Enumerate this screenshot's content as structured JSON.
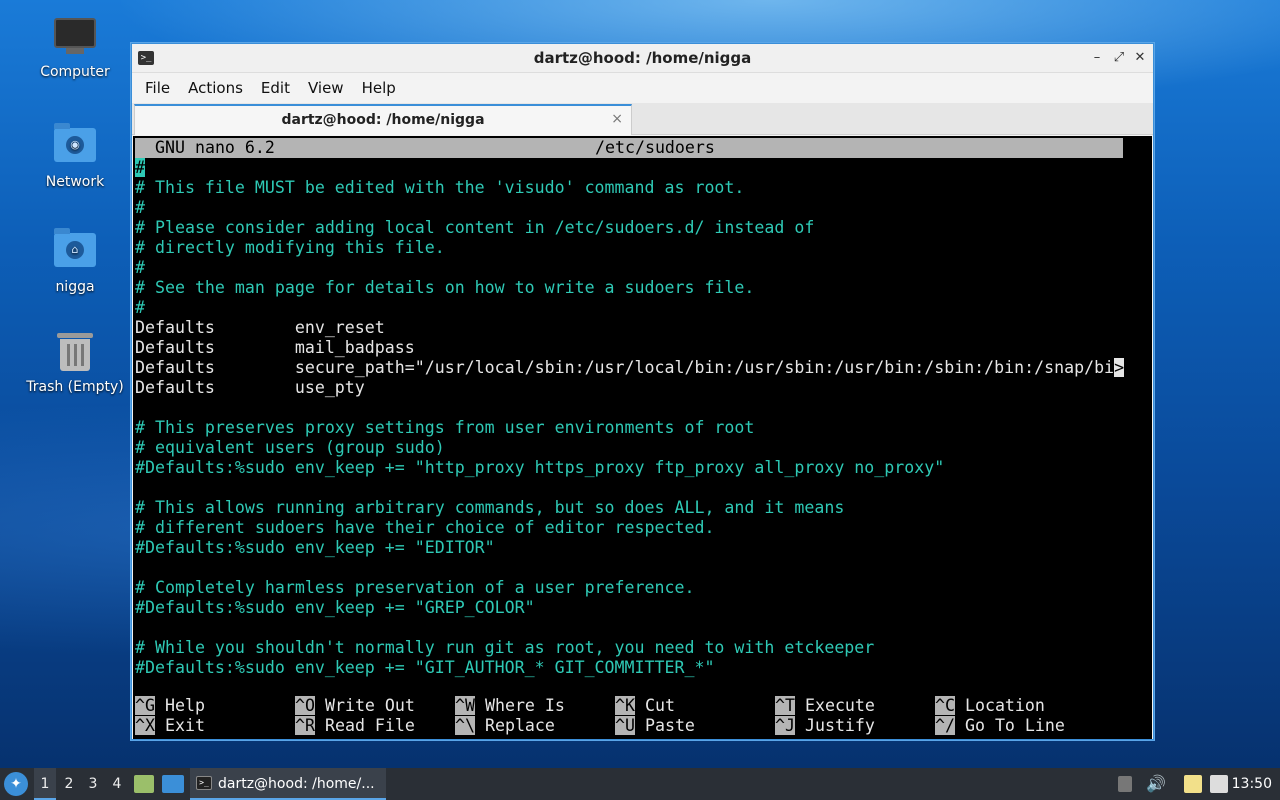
{
  "desktop": {
    "icons": [
      {
        "label": "Computer",
        "icon": "computer-icon"
      },
      {
        "label": "Network",
        "icon": "network-folder-icon"
      },
      {
        "label": "nigga",
        "icon": "home-folder-icon"
      },
      {
        "label": "Trash (Empty)",
        "icon": "trash-icon"
      }
    ]
  },
  "window": {
    "title": "dartz@hood: /home/nigga",
    "menu": [
      "File",
      "Actions",
      "Edit",
      "View",
      "Help"
    ],
    "tab_label": "dartz@hood: /home/nigga",
    "tab_close": "×",
    "controls": {
      "minimize": "–",
      "maximize": "⤢",
      "close": "✕"
    }
  },
  "nano": {
    "version": "GNU nano 6.2",
    "filename": "/etc/sudoers",
    "lines": [
      "#",
      "# This file MUST be edited with the 'visudo' command as root.",
      "#",
      "# Please consider adding local content in /etc/sudoers.d/ instead of",
      "# directly modifying this file.",
      "#",
      "# See the man page for details on how to write a sudoers file.",
      "#",
      "Defaults        env_reset",
      "Defaults        mail_badpass",
      "Defaults        secure_path=\"/usr/local/sbin:/usr/local/bin:/usr/sbin:/usr/bin:/sbin:/bin:/snap/bi",
      "Defaults        use_pty",
      "",
      "# This preserves proxy settings from user environments of root",
      "# equivalent users (group sudo)",
      "#Defaults:%sudo env_keep += \"http_proxy https_proxy ftp_proxy all_proxy no_proxy\"",
      "",
      "# This allows running arbitrary commands, but so does ALL, and it means",
      "# different sudoers have their choice of editor respected.",
      "#Defaults:%sudo env_keep += \"EDITOR\"",
      "",
      "# Completely harmless preservation of a user preference.",
      "#Defaults:%sudo env_keep += \"GREP_COLOR\"",
      "",
      "# While you shouldn't normally run git as root, you need to with etckeeper",
      "#Defaults:%sudo env_keep += \"GIT_AUTHOR_* GIT_COMMITTER_*\""
    ],
    "truncation_marker": ">",
    "shortcuts": [
      [
        {
          "key": "^G",
          "label": "Help"
        },
        {
          "key": "^O",
          "label": "Write Out"
        },
        {
          "key": "^W",
          "label": "Where Is"
        },
        {
          "key": "^K",
          "label": "Cut"
        },
        {
          "key": "^T",
          "label": "Execute"
        },
        {
          "key": "^C",
          "label": "Location"
        }
      ],
      [
        {
          "key": "^X",
          "label": "Exit"
        },
        {
          "key": "^R",
          "label": "Read File"
        },
        {
          "key": "^\\",
          "label": "Replace"
        },
        {
          "key": "^U",
          "label": "Paste"
        },
        {
          "key": "^J",
          "label": "Justify"
        },
        {
          "key": "^/",
          "label": "Go To Line"
        }
      ]
    ]
  },
  "taskbar": {
    "workspaces": [
      "1",
      "2",
      "3",
      "4"
    ],
    "active_workspace": "1",
    "task_label": "dartz@hood: /home/...",
    "clock": "13:50"
  }
}
